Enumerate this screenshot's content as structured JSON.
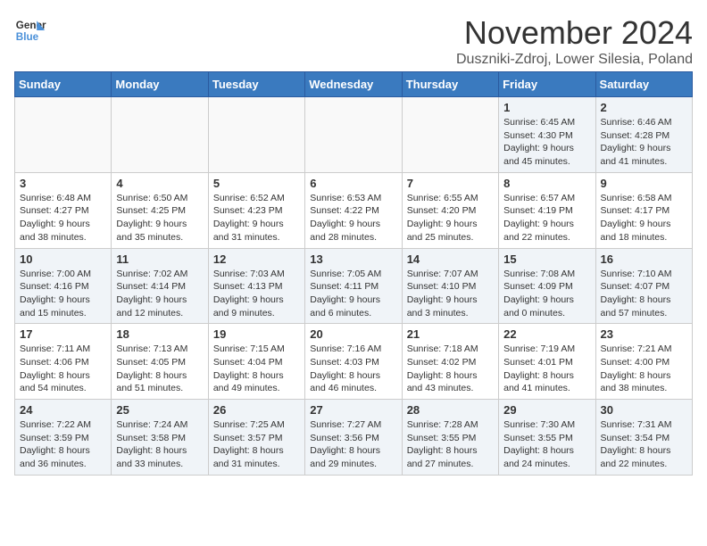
{
  "logo": {
    "line1": "General",
    "line2": "Blue"
  },
  "title": "November 2024",
  "location": "Duszniki-Zdroj, Lower Silesia, Poland",
  "days_of_week": [
    "Sunday",
    "Monday",
    "Tuesday",
    "Wednesday",
    "Thursday",
    "Friday",
    "Saturday"
  ],
  "weeks": [
    [
      {
        "day": "",
        "info": "",
        "empty": true
      },
      {
        "day": "",
        "info": "",
        "empty": true
      },
      {
        "day": "",
        "info": "",
        "empty": true
      },
      {
        "day": "",
        "info": "",
        "empty": true
      },
      {
        "day": "",
        "info": "",
        "empty": true
      },
      {
        "day": "1",
        "info": "Sunrise: 6:45 AM\nSunset: 4:30 PM\nDaylight: 9 hours and 45 minutes."
      },
      {
        "day": "2",
        "info": "Sunrise: 6:46 AM\nSunset: 4:28 PM\nDaylight: 9 hours and 41 minutes."
      }
    ],
    [
      {
        "day": "3",
        "info": "Sunrise: 6:48 AM\nSunset: 4:27 PM\nDaylight: 9 hours and 38 minutes."
      },
      {
        "day": "4",
        "info": "Sunrise: 6:50 AM\nSunset: 4:25 PM\nDaylight: 9 hours and 35 minutes."
      },
      {
        "day": "5",
        "info": "Sunrise: 6:52 AM\nSunset: 4:23 PM\nDaylight: 9 hours and 31 minutes."
      },
      {
        "day": "6",
        "info": "Sunrise: 6:53 AM\nSunset: 4:22 PM\nDaylight: 9 hours and 28 minutes."
      },
      {
        "day": "7",
        "info": "Sunrise: 6:55 AM\nSunset: 4:20 PM\nDaylight: 9 hours and 25 minutes."
      },
      {
        "day": "8",
        "info": "Sunrise: 6:57 AM\nSunset: 4:19 PM\nDaylight: 9 hours and 22 minutes."
      },
      {
        "day": "9",
        "info": "Sunrise: 6:58 AM\nSunset: 4:17 PM\nDaylight: 9 hours and 18 minutes."
      }
    ],
    [
      {
        "day": "10",
        "info": "Sunrise: 7:00 AM\nSunset: 4:16 PM\nDaylight: 9 hours and 15 minutes."
      },
      {
        "day": "11",
        "info": "Sunrise: 7:02 AM\nSunset: 4:14 PM\nDaylight: 9 hours and 12 minutes."
      },
      {
        "day": "12",
        "info": "Sunrise: 7:03 AM\nSunset: 4:13 PM\nDaylight: 9 hours and 9 minutes."
      },
      {
        "day": "13",
        "info": "Sunrise: 7:05 AM\nSunset: 4:11 PM\nDaylight: 9 hours and 6 minutes."
      },
      {
        "day": "14",
        "info": "Sunrise: 7:07 AM\nSunset: 4:10 PM\nDaylight: 9 hours and 3 minutes."
      },
      {
        "day": "15",
        "info": "Sunrise: 7:08 AM\nSunset: 4:09 PM\nDaylight: 9 hours and 0 minutes."
      },
      {
        "day": "16",
        "info": "Sunrise: 7:10 AM\nSunset: 4:07 PM\nDaylight: 8 hours and 57 minutes."
      }
    ],
    [
      {
        "day": "17",
        "info": "Sunrise: 7:11 AM\nSunset: 4:06 PM\nDaylight: 8 hours and 54 minutes."
      },
      {
        "day": "18",
        "info": "Sunrise: 7:13 AM\nSunset: 4:05 PM\nDaylight: 8 hours and 51 minutes."
      },
      {
        "day": "19",
        "info": "Sunrise: 7:15 AM\nSunset: 4:04 PM\nDaylight: 8 hours and 49 minutes."
      },
      {
        "day": "20",
        "info": "Sunrise: 7:16 AM\nSunset: 4:03 PM\nDaylight: 8 hours and 46 minutes."
      },
      {
        "day": "21",
        "info": "Sunrise: 7:18 AM\nSunset: 4:02 PM\nDaylight: 8 hours and 43 minutes."
      },
      {
        "day": "22",
        "info": "Sunrise: 7:19 AM\nSunset: 4:01 PM\nDaylight: 8 hours and 41 minutes."
      },
      {
        "day": "23",
        "info": "Sunrise: 7:21 AM\nSunset: 4:00 PM\nDaylight: 8 hours and 38 minutes."
      }
    ],
    [
      {
        "day": "24",
        "info": "Sunrise: 7:22 AM\nSunset: 3:59 PM\nDaylight: 8 hours and 36 minutes."
      },
      {
        "day": "25",
        "info": "Sunrise: 7:24 AM\nSunset: 3:58 PM\nDaylight: 8 hours and 33 minutes."
      },
      {
        "day": "26",
        "info": "Sunrise: 7:25 AM\nSunset: 3:57 PM\nDaylight: 8 hours and 31 minutes."
      },
      {
        "day": "27",
        "info": "Sunrise: 7:27 AM\nSunset: 3:56 PM\nDaylight: 8 hours and 29 minutes."
      },
      {
        "day": "28",
        "info": "Sunrise: 7:28 AM\nSunset: 3:55 PM\nDaylight: 8 hours and 27 minutes."
      },
      {
        "day": "29",
        "info": "Sunrise: 7:30 AM\nSunset: 3:55 PM\nDaylight: 8 hours and 24 minutes."
      },
      {
        "day": "30",
        "info": "Sunrise: 7:31 AM\nSunset: 3:54 PM\nDaylight: 8 hours and 22 minutes."
      }
    ]
  ]
}
